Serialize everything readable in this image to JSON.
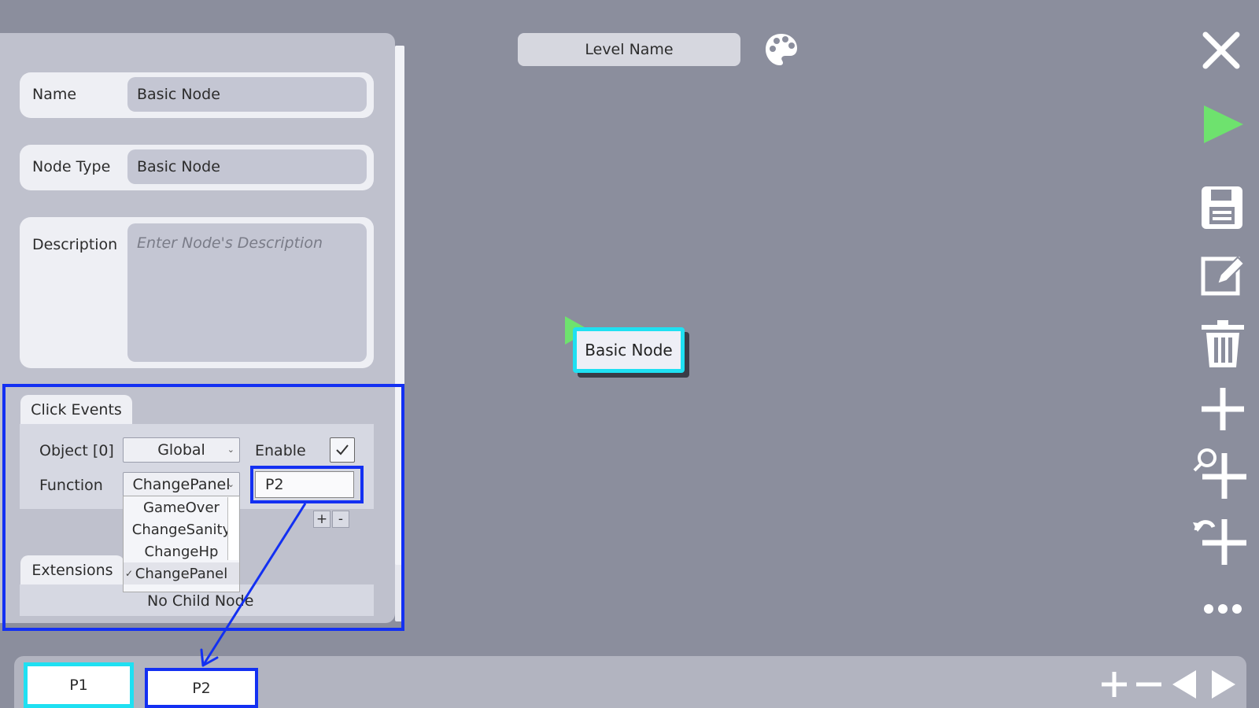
{
  "header": {
    "level_name": "Level Name"
  },
  "inspector": {
    "name_label": "Name",
    "name_value": "Basic Node",
    "node_type_label": "Node Type",
    "node_type_value": "Basic Node",
    "description_label": "Description",
    "description_placeholder": "Enter Node's Description",
    "click_events": {
      "tab_label": "Click Events",
      "object_label": "Object [0]",
      "object_value": "Global",
      "enable_label": "Enable",
      "enable_checked": true,
      "function_label": "Function",
      "function_value": "ChangePanel",
      "parameter_value": "P2",
      "add_label": "+",
      "remove_label": "-",
      "function_options": [
        "GameOver",
        "ChangeSanity",
        "ChangeHp",
        "ChangePanel"
      ],
      "selected_option": "ChangePanel"
    },
    "extensions": {
      "tab_label": "Extensions",
      "empty_text": "No Child Node"
    }
  },
  "canvas": {
    "node_label": "Basic Node"
  },
  "toolbar": {
    "icons": [
      "close-icon",
      "play-icon",
      "save-icon",
      "edit-icon",
      "trash-icon",
      "add-icon",
      "zoom-add-icon",
      "undo-add-icon",
      "more-icon"
    ]
  },
  "pages": {
    "tabs": [
      "P1",
      "P2"
    ],
    "active": "P1",
    "add_label": "+",
    "remove_label": "−"
  },
  "colors": {
    "background": "#8b8e9d",
    "accent_cyan": "#1fe0f2",
    "highlight_blue": "#1330f2",
    "play_green": "#6ee26e"
  }
}
